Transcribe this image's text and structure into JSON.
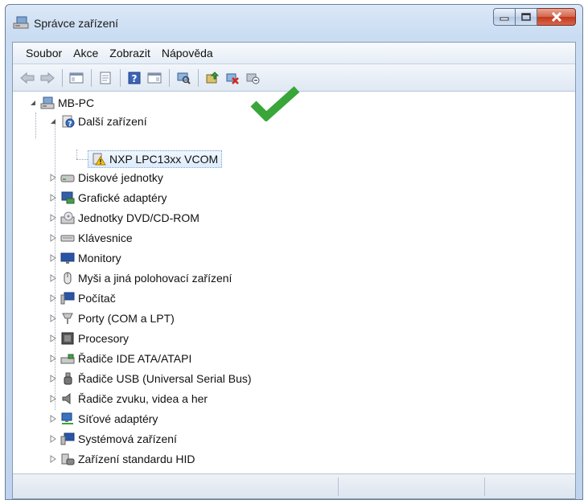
{
  "window": {
    "title": "Správce zařízení"
  },
  "menu": [
    "Soubor",
    "Akce",
    "Zobrazit",
    "Nápověda"
  ],
  "toolbar_icons": [
    "back-arrow-icon",
    "forward-arrow-icon",
    "show-hide-console-tree-icon",
    "properties-icon",
    "help-icon",
    "action-pane-icon",
    "scan-hardware-icon",
    "update-driver-icon",
    "uninstall-icon",
    "disable-device-icon"
  ],
  "tree": {
    "root": "MB-PC",
    "other_devices": "Další zařízení",
    "selected_device": "NXP LPC13xx VCOM",
    "categories": [
      "Diskové jednotky",
      "Grafické adaptéry",
      "Jednotky DVD/CD-ROM",
      "Klávesnice",
      "Monitory",
      "Myši a jiná polohovací zařízení",
      "Počítač",
      "Porty (COM a LPT)",
      "Procesory",
      "Řadiče IDE ATA/ATAPI",
      "Řadiče USB (Universal Serial Bus)",
      "Řadiče zvuku, videa a her",
      "Síťové adaptéry",
      "Systémová zařízení",
      "Zařízení standardu HID"
    ]
  },
  "colors": {
    "check": "#3aa63a",
    "selection": "#dcebfc",
    "close_button": "#c3391c"
  }
}
